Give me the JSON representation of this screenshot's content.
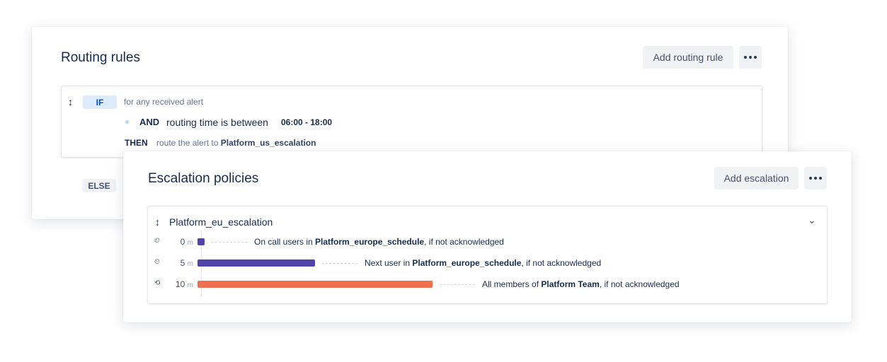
{
  "routing": {
    "title": "Routing rules",
    "add_label": "Add routing rule",
    "rule": {
      "if_label": "IF",
      "if_text": "for any received alert",
      "and_label": "AND",
      "and_text": "routing time is between",
      "time_range": "06:00 - 18:00",
      "then_label": "THEN",
      "then_text": "route the alert to",
      "then_target": "Platform_us_escalation"
    },
    "else_label": "ELSE"
  },
  "escalation": {
    "title": "Escalation policies",
    "add_label": "Add escalation",
    "policy": {
      "name": "Platform_eu_escalation",
      "steps": [
        {
          "icon": "timer-icon",
          "delay": "0",
          "unit": "m",
          "delay_minutes": 0,
          "color": "#5243aa",
          "pre": "On call users in ",
          "target": "Platform_europe_schedule",
          "post": ", if not acknowledged"
        },
        {
          "icon": "timer-icon",
          "delay": "5",
          "unit": "m",
          "delay_minutes": 5,
          "color": "#5243aa",
          "pre": "Next user in ",
          "target": "Platform_europe_schedule",
          "post": ", if not acknowledged"
        },
        {
          "icon": "team-icon",
          "delay": "10",
          "unit": "m",
          "delay_minutes": 10,
          "color": "#ef7050",
          "pre": "All members of ",
          "target": "Platform Team",
          "post": ", if not acknowledged"
        }
      ]
    }
  }
}
